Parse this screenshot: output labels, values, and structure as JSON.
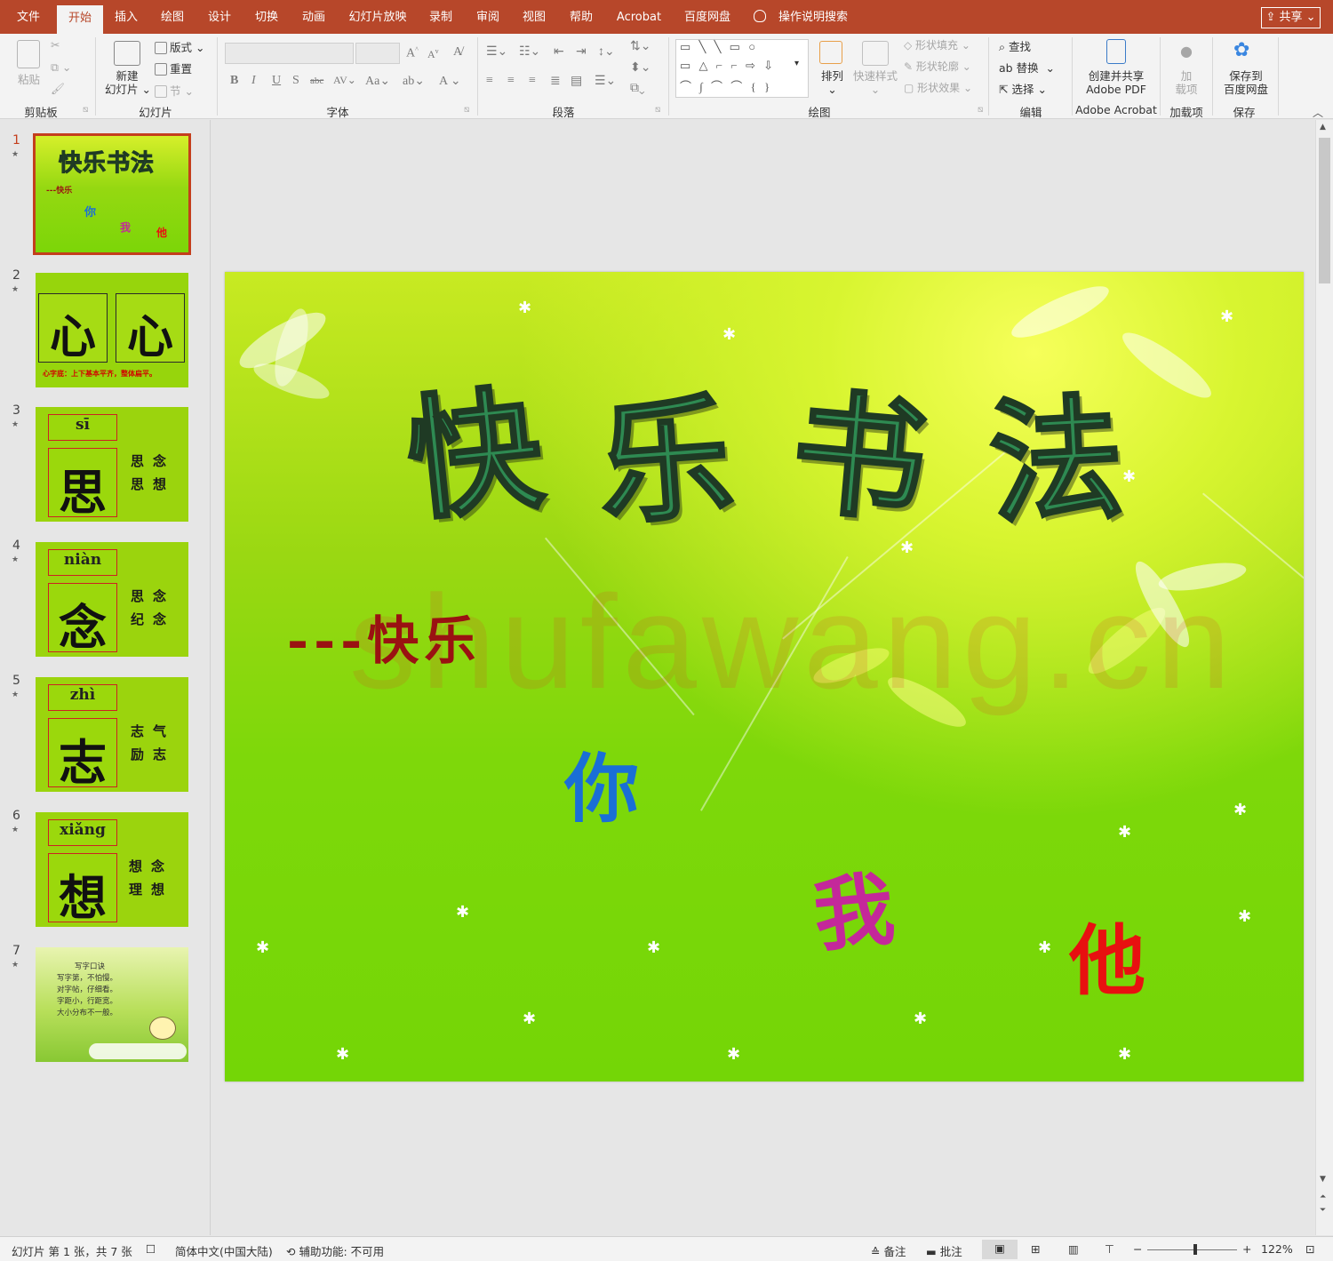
{
  "ribbon_tabs": [
    "文件",
    "开始",
    "插入",
    "绘图",
    "设计",
    "切换",
    "动画",
    "幻灯片放映",
    "录制",
    "审阅",
    "视图",
    "帮助",
    "Acrobat",
    "百度网盘"
  ],
  "active_tab": "开始",
  "tell_me": "操作说明搜索",
  "share": "共享",
  "ribbon": {
    "clipboard": {
      "paste": "粘贴",
      "label": "剪贴板"
    },
    "slides": {
      "new_slide_1": "新建",
      "new_slide_2": "幻灯片",
      "layout": "版式",
      "reset": "重置",
      "section": "节",
      "label": "幻灯片"
    },
    "font": {
      "label": "字体"
    },
    "paragraph": {
      "label": "段落"
    },
    "drawing": {
      "arrange": "排列",
      "quick_styles": "快速样式",
      "shape_fill": "形状填充",
      "shape_outline": "形状轮廓",
      "shape_effects": "形状效果",
      "label": "绘图"
    },
    "editing": {
      "find": "查找",
      "replace": "替换",
      "select": "选择",
      "label": "编辑"
    },
    "acrobat": {
      "create_1": "创建并共享",
      "create_2": "Adobe PDF",
      "label": "Adobe Acrobat"
    },
    "addins": {
      "add_1": "加",
      "add_2": "载项",
      "label": "加载项"
    },
    "baidu": {
      "save_1": "保存到",
      "save_2": "百度网盘",
      "label": "保存"
    }
  },
  "thumbnails": [
    {
      "num": "1",
      "title": "快乐书法",
      "sub": "---快乐",
      "c1": "你",
      "c2": "我",
      "c3": "他"
    },
    {
      "num": "2",
      "char": "心",
      "note": "心字底：上下基本平齐，整体扁平。"
    },
    {
      "num": "3",
      "pinyin": "sī",
      "char": "思",
      "words": [
        "思",
        "念",
        "思",
        "想"
      ]
    },
    {
      "num": "4",
      "pinyin": "niàn",
      "char": "念",
      "words": [
        "思",
        "念",
        "纪",
        "念"
      ]
    },
    {
      "num": "5",
      "pinyin": "zhì",
      "char": "志",
      "words": [
        "志",
        "气",
        "励",
        "志"
      ]
    },
    {
      "num": "6",
      "pinyin": "xiǎng",
      "char": "想",
      "words": [
        "想",
        "念",
        "理",
        "想"
      ]
    },
    {
      "num": "7",
      "lines": [
        "写字口诀",
        "写字第，不怕慢。",
        "对字帖，仔细看。",
        "字距小，行距宽。",
        "大小分布不一般。"
      ]
    }
  ],
  "slide": {
    "title_chars": [
      "快",
      "乐",
      "书",
      "法"
    ],
    "subtitle": "---快乐",
    "char_you": "你",
    "char_me": "我",
    "char_him": "他",
    "watermark": "shufawang.cn",
    "colors": {
      "title": "#2e8a52",
      "subtitle": "#9a1212",
      "you": "#1a6fd6",
      "me": "#c4289a",
      "him": "#e81010"
    }
  },
  "status": {
    "slide_info": "幻灯片 第 1 张，共 7 张",
    "language": "简体中文(中国大陆)",
    "accessibility": "辅助功能: 不可用",
    "notes": "备注",
    "comments": "批注",
    "zoom": "122%"
  }
}
